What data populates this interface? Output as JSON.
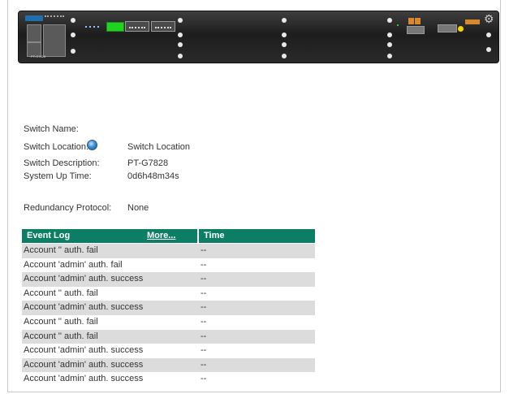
{
  "device": {
    "logo_text": "MOXA",
    "model_text": "PT-G7828",
    "gear_icon": "gear-icon"
  },
  "info": {
    "switch_name_label": "Switch Name:",
    "switch_name_value": "",
    "switch_location_label": "Switch Location:",
    "switch_location_value": "Switch Location",
    "switch_description_label": "Switch Description:",
    "switch_description_value": "PT-G7828",
    "system_up_time_label": "System Up Time:",
    "system_up_time_value": "0d6h48m34s",
    "redundancy_protocol_label": "Redundancy Protocol:",
    "redundancy_protocol_value": "None"
  },
  "event_log": {
    "header_event": "Event Log",
    "header_more": "More...",
    "header_time": "Time",
    "rows": [
      {
        "event": "Account '' auth. fail",
        "time": "--"
      },
      {
        "event": "Account 'admin' auth. fail",
        "time": "--"
      },
      {
        "event": "Account 'admin' auth. success",
        "time": "--"
      },
      {
        "event": "Account '' auth. fail",
        "time": "--"
      },
      {
        "event": "Account 'admin' auth. success",
        "time": "--"
      },
      {
        "event": "Account '' auth. fail",
        "time": "--"
      },
      {
        "event": "Account '' auth. fail",
        "time": "--"
      },
      {
        "event": "Account 'admin' auth. success",
        "time": "--"
      },
      {
        "event": "Account 'admin' auth. success",
        "time": "--"
      },
      {
        "event": "Account 'admin' auth. success",
        "time": "--"
      }
    ]
  },
  "colors": {
    "header_green": "#0b7e64",
    "row_alt": "#dcdcdc",
    "port_active": "#21d321"
  }
}
